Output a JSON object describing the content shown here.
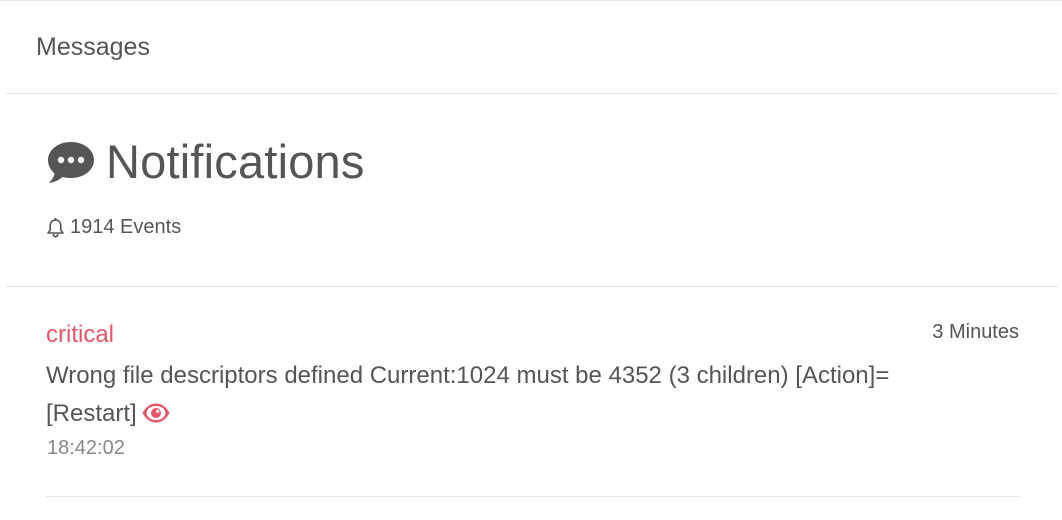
{
  "header": {
    "title": "Messages"
  },
  "notifications": {
    "title": "Notifications",
    "events_count": "1914 Events"
  },
  "events": [
    {
      "severity": "critical",
      "time_ago": "3 Minutes",
      "message": "Wrong file descriptors defined Current:1024 must be 4352 (3 children) [Action]= [Restart]",
      "timestamp": "18:42:02"
    }
  ],
  "colors": {
    "critical": "#e5566b",
    "text": "#555555",
    "muted": "#888888",
    "divider": "#e3e3e3"
  }
}
